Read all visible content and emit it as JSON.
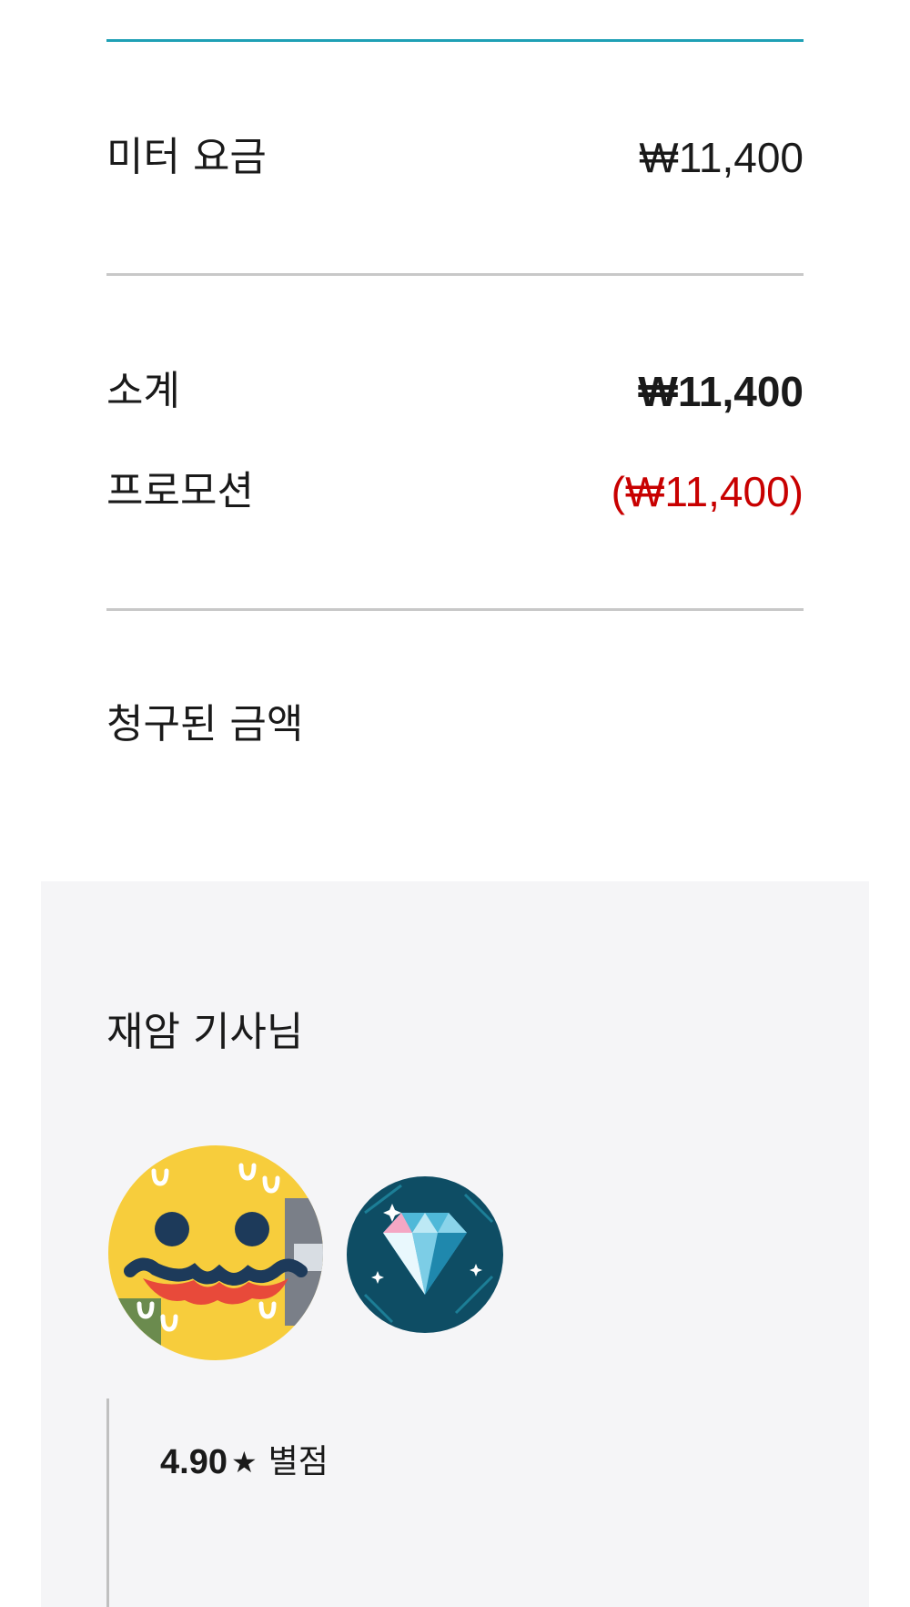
{
  "fare": {
    "meter_label": "미터 요금",
    "meter_amount": "₩11,400",
    "subtotal_label": "소계",
    "subtotal_amount": "₩11,400",
    "promotion_label": "프로모션",
    "promotion_amount": "(₩11,400)",
    "charged_label": "청구된 금액"
  },
  "driver": {
    "name": "재암 기사님",
    "rating_value": "4.90",
    "rating_star": "★",
    "rating_label": "별점",
    "avatar_icon": "smiley-face-avatar-icon",
    "badge_icon": "diamond-badge-icon"
  },
  "colors": {
    "accent": "#1fa0b5",
    "promotion": "#c80000",
    "panel_bg": "#f5f5f7",
    "badge_bg": "#0e4d64"
  }
}
